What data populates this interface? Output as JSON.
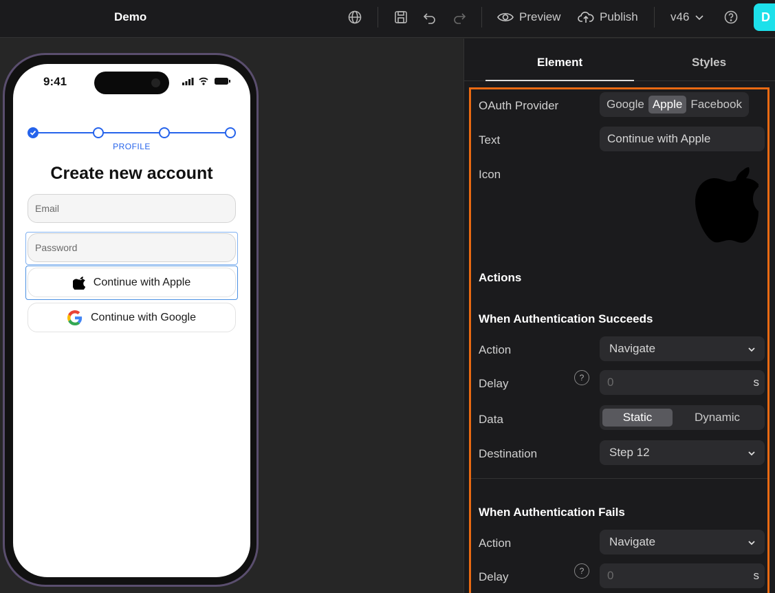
{
  "topbar": {
    "title": "Demo",
    "preview_label": "Preview",
    "publish_label": "Publish",
    "version_label": "v46",
    "avatar_initial": "D"
  },
  "phone": {
    "time": "9:41",
    "step_label": "PROFILE",
    "title": "Create new account",
    "email_placeholder": "Email",
    "password_placeholder": "Password",
    "apple_button_label": "Continue with Apple",
    "google_button_label": "Continue with Google"
  },
  "panel": {
    "tabs": [
      "Element",
      "Styles"
    ],
    "active_tab": "Element",
    "oauth_label": "OAuth Provider",
    "oauth_options": [
      "Google",
      "Apple",
      "Facebook"
    ],
    "oauth_selected": "Apple",
    "text_label": "Text",
    "text_value": "Continue with Apple",
    "icon_label": "Icon",
    "actions_title": "Actions",
    "success_title": "When Authentication Succeeds",
    "success": {
      "action_label": "Action",
      "action_value": "Navigate",
      "delay_label": "Delay",
      "delay_value": "0",
      "delay_unit": "s",
      "help_glyph": "?",
      "data_label": "Data",
      "data_options": [
        "Static",
        "Dynamic"
      ],
      "data_selected": "Static",
      "destination_label": "Destination",
      "destination_value": "Step 12"
    },
    "fail_title": "When Authentication Fails",
    "fail": {
      "action_label": "Action",
      "action_value": "Navigate",
      "delay_label": "Delay",
      "delay_value": "0",
      "delay_unit": "s",
      "help_glyph": "?"
    },
    "highlight_color": "#ea6a12"
  }
}
